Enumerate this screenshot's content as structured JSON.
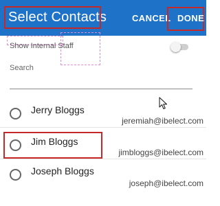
{
  "header": {
    "title": "Select Contacts",
    "cancel_label": "CANCEL",
    "done_label": "DONE"
  },
  "filters": {
    "internal_staff_label": "Show Internal Staff",
    "internal_staff_on": false,
    "search_label": "Search",
    "search_value": ""
  },
  "contacts": [
    {
      "name": "Jerry Bloggs",
      "email": "jeremiah@ibelect.com",
      "selected": false
    },
    {
      "name": "Jim Bloggs",
      "email": "jimbloggs@ibelect.com",
      "selected": false
    },
    {
      "name": "Joseph Bloggs",
      "email": "joseph@ibelect.com",
      "selected": false
    }
  ],
  "colors": {
    "app_bar": "#1e73c8",
    "highlight": "#c62828",
    "ghost_outline": "#e38bd6"
  },
  "icons": {
    "pointer": "mouse-pointer-icon"
  }
}
